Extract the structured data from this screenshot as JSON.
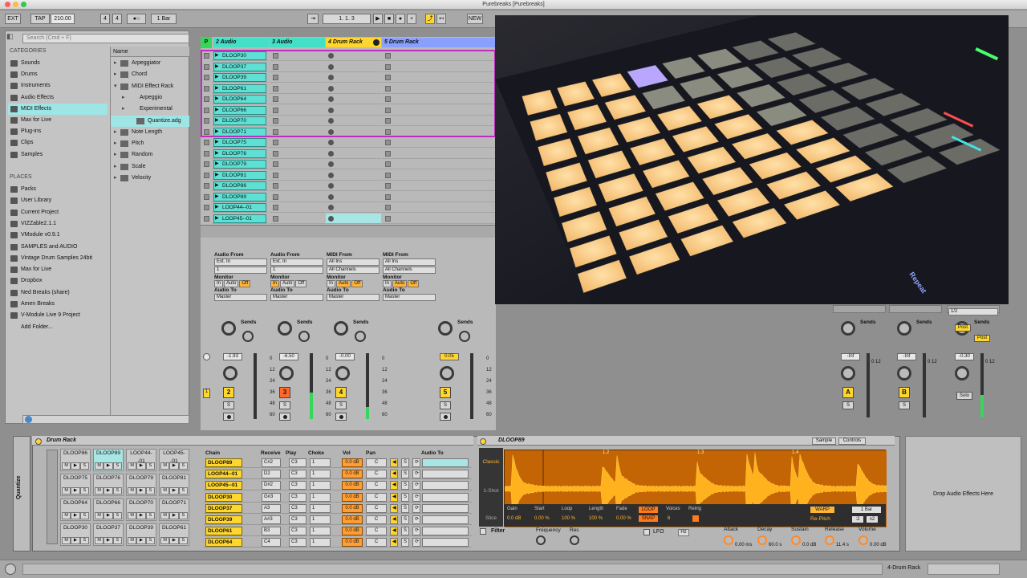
{
  "window": {
    "title": "Purebreaks  [Purebreaks]"
  },
  "transport": {
    "ext": "EXT",
    "tap": "TAP",
    "tempo": "210.00",
    "sig_num": "4",
    "sig_den": "4",
    "quant": "1 Bar",
    "position": "1.   1.   3",
    "new": "NEW"
  },
  "browser": {
    "search_placeholder": "Search (Cmd + F)",
    "categories_header": "CATEGORIES",
    "categories": [
      "Sounds",
      "Drums",
      "Instruments",
      "Audio Effects",
      "MIDI Effects",
      "Max for Live",
      "Plug-ins",
      "Clips",
      "Samples"
    ],
    "selected_category": "MIDI Effects",
    "places_header": "PLACES",
    "places": [
      "Packs",
      "User Library",
      "Current Project",
      "VIZZable2.1.1",
      "VModule v0.9.1",
      "SAMPLES and AUDIO",
      "Vintage Drum Samples 24bit",
      "Max for Live",
      "Dropbox",
      "Ned Breaks (share)",
      "Amen Breaks",
      "V-Module Live 9 Project",
      "Add Folder..."
    ],
    "name_header": "Name",
    "items": [
      {
        "label": "Arpeggiator",
        "level": 0
      },
      {
        "label": "Chord",
        "level": 0
      },
      {
        "label": "MIDI Effect Rack",
        "level": 0
      },
      {
        "label": "Arpeggio",
        "level": 1
      },
      {
        "label": "Experimental",
        "level": 1
      },
      {
        "label": "Quantize.adg",
        "level": 2
      },
      {
        "label": "Note Length",
        "level": 0
      },
      {
        "label": "Pitch",
        "level": 0
      },
      {
        "label": "Random",
        "level": 0
      },
      {
        "label": "Scale",
        "level": 0
      },
      {
        "label": "Velocity",
        "level": 0
      }
    ]
  },
  "session": {
    "master_letter": "P",
    "tracks": [
      {
        "name": "2 Audio",
        "color": "#43e0c7"
      },
      {
        "name": "3 Audio",
        "color": "#43e0c7"
      },
      {
        "name": "4 Drum Rack",
        "color": "#ffd62e"
      },
      {
        "name": "5 Drum Rack",
        "color": "#8aa0ff"
      }
    ],
    "clips": [
      "DLOOP30",
      "DLOOP37",
      "DLOOP39",
      "DLOOP61",
      "DLOOP64",
      "DLOOP66",
      "DLOOP70",
      "DLOOP71",
      "DLOOP75",
      "DLOOP76",
      "DLOOP79",
      "DLOOP81",
      "DLOOP86",
      "DLOOP89",
      "LOOP44--01",
      "LOOP45--01"
    ],
    "io": [
      {
        "from_label": "Audio From",
        "from": "Ext. In",
        "ch": "1",
        "mon": "Monitor",
        "to_label": "Audio To",
        "to": "Master"
      },
      {
        "from_label": "Audio From",
        "from": "Ext. In",
        "ch": "1",
        "mon": "Monitor",
        "to_label": "Audio To",
        "to": "Master"
      },
      {
        "from_label": "MIDI From",
        "from": "All Ins",
        "ch": "All Channels",
        "mon": "Monitor",
        "to_label": "Audio To",
        "to": "Master"
      },
      {
        "from_label": "MIDI From",
        "from": "All Ins",
        "ch": "All Channels",
        "mon": "Monitor",
        "to_label": "Audio To",
        "to": "Master"
      }
    ],
    "mon_btns": [
      "In",
      "Auto",
      "Off"
    ],
    "sends_label": "Sends",
    "mixer": [
      {
        "vol": "-1.93",
        "num": "2",
        "solo": "S"
      },
      {
        "vol": "-6.50",
        "num": "3",
        "solo": "S"
      },
      {
        "vol": "-0.00",
        "num": "4",
        "solo": "S"
      },
      {
        "vol": "0.05",
        "num": "5",
        "solo": "S"
      }
    ],
    "scale": [
      "0",
      "12",
      "24",
      "36",
      "48",
      "60"
    ],
    "returns": [
      {
        "vol": "-Inf",
        "letter": "A",
        "solo": "S"
      },
      {
        "vol": "-Inf",
        "letter": "B",
        "solo": "S"
      },
      {
        "vol": "-0.30",
        "letter": "",
        "solo": "Solo"
      }
    ],
    "master_cue": "1/2",
    "post": "Post"
  },
  "photo": {
    "overlay_text": "Repeat"
  },
  "drum_rack": {
    "title": "Drum Rack",
    "pads": [
      [
        "DLOOP86",
        "DLOOP89",
        "LOOP44--01",
        "LOOP45--01"
      ],
      [
        "DLOOP75",
        "DLOOP76",
        "DLOOP79",
        "DLOOP81"
      ],
      [
        "DLOOP64",
        "DLOOP66",
        "DLOOP70",
        "DLOOP71"
      ],
      [
        "DLOOP30",
        "DLOOP37",
        "DLOOP39",
        "DLOOP61"
      ]
    ],
    "pad_btns": [
      "M",
      "▶",
      "S"
    ],
    "selected_pad": "DLOOP89",
    "chain_headers": [
      "Chain",
      "Receive",
      "Play",
      "Choke",
      "Vol",
      "Pan",
      "Audio To"
    ],
    "chains": [
      {
        "name": "DLOOP89",
        "recv": "C#2",
        "play": "C3",
        "choke": "1",
        "vol": "0.0 dB",
        "pan": "C"
      },
      {
        "name": "LOOP44--01",
        "recv": "D2",
        "play": "C3",
        "choke": "1",
        "vol": "0.0 dB",
        "pan": "C"
      },
      {
        "name": "LOOP45--01",
        "recv": "D#2",
        "play": "C3",
        "choke": "1",
        "vol": "0.0 dB",
        "pan": "C"
      },
      {
        "name": "DLOOP30",
        "recv": "G#3",
        "play": "C3",
        "choke": "1",
        "vol": "0.0 dB",
        "pan": "C"
      },
      {
        "name": "DLOOP37",
        "recv": "A3",
        "play": "C3",
        "choke": "1",
        "vol": "0.0 dB",
        "pan": "C"
      },
      {
        "name": "DLOOP39",
        "recv": "A#3",
        "play": "C3",
        "choke": "1",
        "vol": "0.0 dB",
        "pan": "C"
      },
      {
        "name": "DLOOP61",
        "recv": "B3",
        "play": "C3",
        "choke": "1",
        "vol": "0.0 dB",
        "pan": "C"
      },
      {
        "name": "DLOOP64",
        "recv": "C4",
        "play": "C3",
        "choke": "1",
        "vol": "0.0 dB",
        "pan": "C"
      }
    ],
    "side_label": "Quantize"
  },
  "sampler": {
    "title": "DLOOP89",
    "tabs": [
      "Sample",
      "Controls"
    ],
    "modes": [
      "Classic",
      "1-Shot",
      "Slice"
    ],
    "params": [
      {
        "label": "Gain",
        "value": "0.0 dB"
      },
      {
        "label": "Start",
        "value": "0.00 %"
      },
      {
        "label": "Loop",
        "value": "100 %"
      },
      {
        "label": "Length",
        "value": "100 %"
      },
      {
        "label": "Fade",
        "value": "0.00 %"
      }
    ],
    "loop_btn": "LOOP",
    "snap_btn": "SNAP",
    "voices_label": "Voices",
    "voices": "6",
    "retrig_label": "Retrig",
    "warp_btn": "WARP",
    "bars": "1 Bar",
    "repitch": "Re-Pitch",
    "x2": "x2",
    "div": ":2",
    "markers": [
      "1.2",
      "1.3",
      "1.4"
    ],
    "filter_label": "Filter",
    "freq_label": "Frequency",
    "res_label": "Res",
    "lfo_label": "LFO",
    "hz": "Hz",
    "env": [
      {
        "label": "Attack",
        "value": "0.00 ms"
      },
      {
        "label": "Decay",
        "value": "60.0 s"
      },
      {
        "label": "Sustain",
        "value": "0.0 dB"
      },
      {
        "label": "Release",
        "value": "11.4 s"
      },
      {
        "label": "Volume",
        "value": "0.00 dB"
      }
    ]
  },
  "audio_fx": {
    "drop_text": "Drop Audio Effects Here"
  },
  "status": {
    "track_label": "4-Drum Rack"
  }
}
